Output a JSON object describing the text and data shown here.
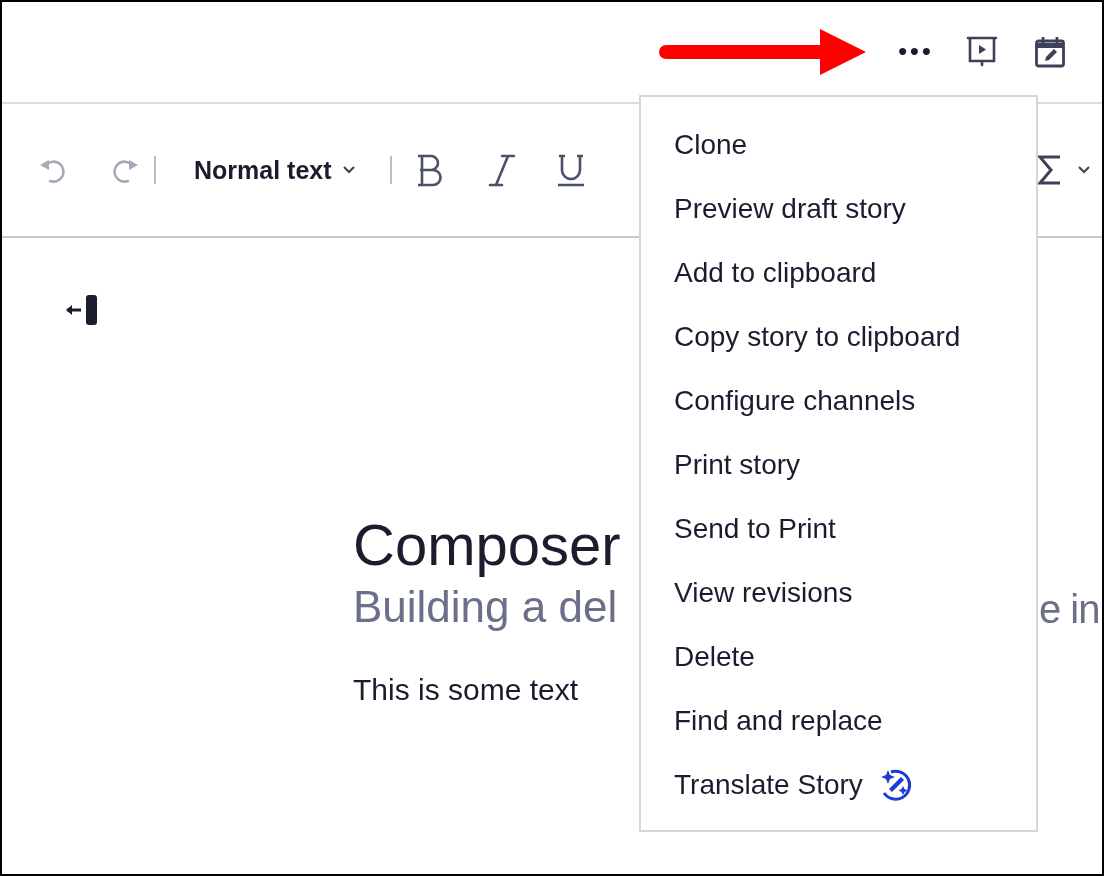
{
  "header": {
    "more_label": "•••"
  },
  "toolbar": {
    "history": [
      {
        "kind": "undo",
        "disabled": true
      },
      {
        "kind": "redo",
        "disabled": true
      }
    ],
    "style_select": "Normal text",
    "formats": [
      {
        "kind": "bold"
      },
      {
        "kind": "italic"
      },
      {
        "kind": "underline"
      },
      {
        "kind": "sum"
      }
    ]
  },
  "document": {
    "title": "Composer",
    "subtitle": "Building a del",
    "subtitle_tail": "e in",
    "body": "This is some text"
  },
  "menu": {
    "items": [
      {
        "label": "Clone",
        "kind": "plain"
      },
      {
        "label": "Preview draft story",
        "kind": "plain"
      },
      {
        "label": "Add to clipboard",
        "kind": "plain"
      },
      {
        "label": "Copy story to clipboard",
        "kind": "plain"
      },
      {
        "label": "Configure channels",
        "kind": "plain"
      },
      {
        "label": "Print story",
        "kind": "plain"
      },
      {
        "label": "Send to Print",
        "kind": "plain"
      },
      {
        "label": "View revisions",
        "kind": "plain"
      },
      {
        "label": "Delete",
        "kind": "plain"
      },
      {
        "label": "Find and replace",
        "kind": "plain"
      },
      {
        "label": "Translate Story",
        "kind": "ai"
      }
    ]
  }
}
